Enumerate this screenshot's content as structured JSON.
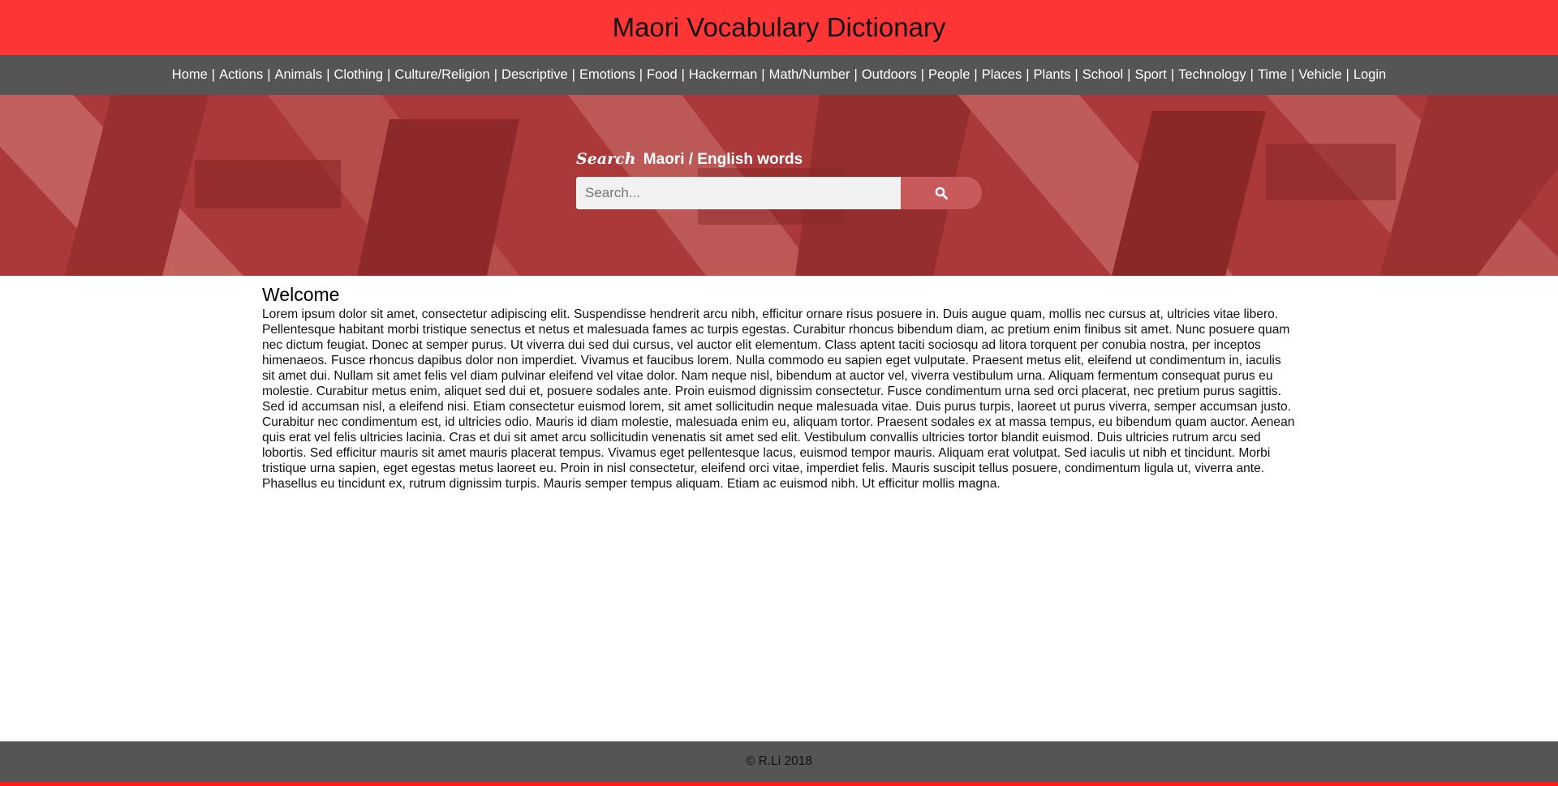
{
  "header": {
    "title": "Maori Vocabulary Dictionary"
  },
  "nav": {
    "separator": "|",
    "items": [
      {
        "label": "Home"
      },
      {
        "label": "Actions"
      },
      {
        "label": "Animals"
      },
      {
        "label": "Clothing"
      },
      {
        "label": "Culture/Religion"
      },
      {
        "label": "Descriptive"
      },
      {
        "label": "Emotions"
      },
      {
        "label": "Food"
      },
      {
        "label": "Hackerman"
      },
      {
        "label": "Math/Number"
      },
      {
        "label": "Outdoors"
      },
      {
        "label": "People"
      },
      {
        "label": "Places"
      },
      {
        "label": "Plants"
      },
      {
        "label": "School"
      },
      {
        "label": "Sport"
      },
      {
        "label": "Technology"
      },
      {
        "label": "Time"
      },
      {
        "label": "Vehicle"
      },
      {
        "label": "Login"
      }
    ]
  },
  "search": {
    "heading_emphasis": "Search",
    "heading_text": "Maori / English words",
    "placeholder": "Search...",
    "value": "",
    "button_icon": "search-icon"
  },
  "main": {
    "title": "Welcome",
    "body": "Lorem ipsum dolor sit amet, consectetur adipiscing elit. Suspendisse hendrerit arcu nibh, efficitur ornare risus posuere in. Duis augue quam, mollis nec cursus at, ultricies vitae libero. Pellentesque habitant morbi tristique senectus et netus et malesuada fames ac turpis egestas. Curabitur rhoncus bibendum diam, ac pretium enim finibus sit amet. Nunc posuere quam nec dictum feugiat. Donec at semper purus. Ut viverra dui sed dui cursus, vel auctor elit elementum. Class aptent taciti sociosqu ad litora torquent per conubia nostra, per inceptos himenaeos. Fusce rhoncus dapibus dolor non imperdiet. Vivamus et faucibus lorem. Nulla commodo eu sapien eget vulputate. Praesent metus elit, eleifend ut condimentum in, iaculis sit amet dui. Nullam sit amet felis vel diam pulvinar eleifend vel vitae dolor. Nam neque nisl, bibendum at auctor vel, viverra vestibulum urna. Aliquam fermentum consequat purus eu molestie. Curabitur metus enim, aliquet sed dui et, posuere sodales ante. Proin euismod dignissim consectetur. Fusce condimentum urna sed orci placerat, nec pretium purus sagittis. Sed id accumsan nisl, a eleifend nisi. Etiam consectetur euismod lorem, sit amet sollicitudin neque malesuada vitae. Duis purus turpis, laoreet ut purus viverra, semper accumsan justo. Curabitur nec condimentum est, id ultricies odio. Mauris id diam molestie, malesuada enim eu, aliquam tortor. Praesent sodales ex at massa tempus, eu bibendum quam auctor. Aenean quis erat vel felis ultricies lacinia. Cras et dui sit amet arcu sollicitudin venenatis sit amet sed elit. Vestibulum convallis ultricies tortor blandit euismod. Duis ultricies rutrum arcu sed lobortis. Sed efficitur mauris sit amet mauris placerat tempus. Vivamus eget pellentesque lacus, euismod tempor mauris. Aliquam erat volutpat. Sed iaculis ut nibh et tincidunt. Morbi tristique urna sapien, eget egestas metus laoreet eu. Proin in nisl consectetur, eleifend orci vitae, imperdiet felis. Mauris suscipit tellus posuere, condimentum ligula ut, viverra ante. Phasellus eu tincidunt ex, rutrum dignissim turpis. Mauris semper tempus aliquam. Etiam ac euismod nibh. Ut efficitur mollis magna."
  },
  "footer": {
    "text": "© R.Li 2018"
  },
  "colors": {
    "header_bg": "#fe3535",
    "nav_bg": "#555555",
    "hero_tint": "#a8393a",
    "search_button": "#c95a5b",
    "footer_bg": "#555555",
    "footer_accent": "#fe1a1a"
  }
}
